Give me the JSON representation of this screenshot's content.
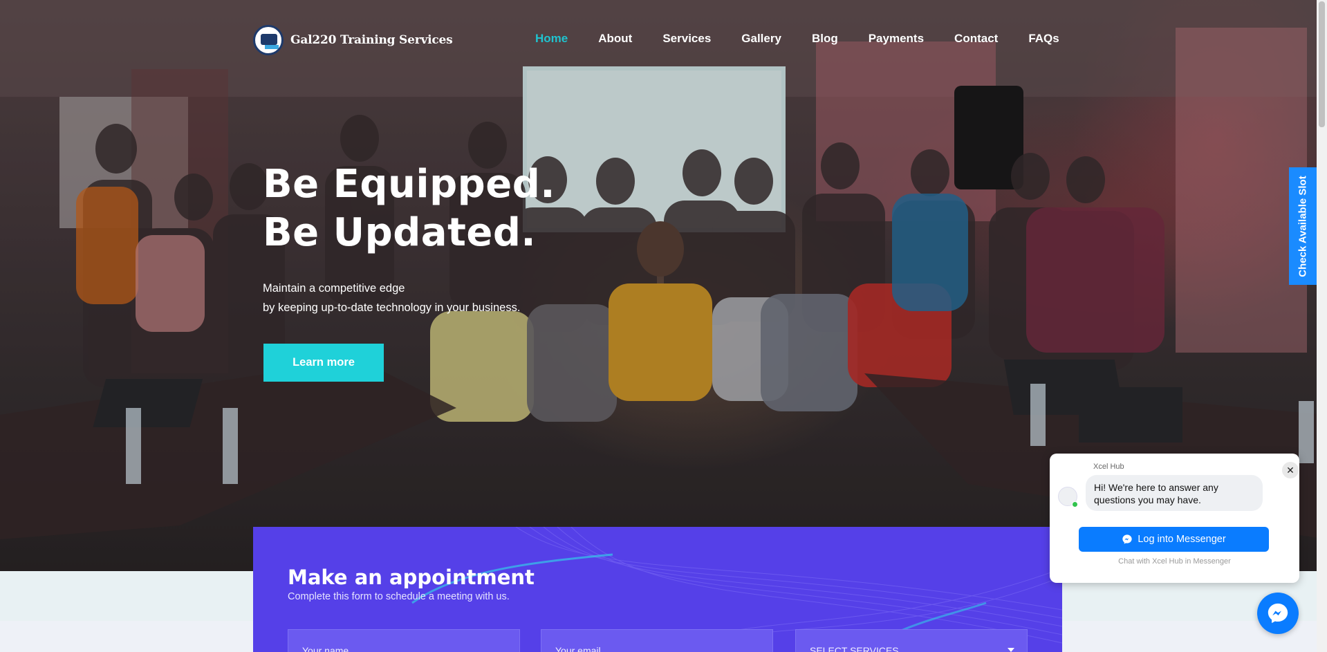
{
  "header": {
    "brand": "Gal220 Training Services",
    "nav": [
      {
        "label": "Home",
        "active": true
      },
      {
        "label": "About"
      },
      {
        "label": "Services"
      },
      {
        "label": "Gallery"
      },
      {
        "label": "Blog"
      },
      {
        "label": "Payments"
      },
      {
        "label": "Contact"
      },
      {
        "label": "FAQs"
      }
    ]
  },
  "hero": {
    "headline_line1": "Be Equipped.",
    "headline_line2": "Be Updated.",
    "sub_line1": "Maintain a competitive edge",
    "sub_line2": "by keeping up-to-date technology in your business.",
    "cta": "Learn more"
  },
  "side_tab": {
    "label": "Check Available Slot"
  },
  "appointment": {
    "title": "Make an appointment",
    "subtitle": "Complete this form to schedule a meeting with us.",
    "name_placeholder": "Your name",
    "email_placeholder": "Your email",
    "service_select": "SELECT SERVICES"
  },
  "messenger": {
    "page_name": "Xcel Hub",
    "greeting": "Hi! We're here to answer any questions you may have.",
    "login_button": "Log into Messenger",
    "footer": "Chat with Xcel Hub in Messenger"
  },
  "colors": {
    "accent": "#1fc3cf",
    "cta": "#1fd1d9",
    "appointment_bg": "#5540e8",
    "messenger_blue": "#0a7cff",
    "side_tab": "#1a8bff"
  },
  "icons": [
    "brand-logo-icon",
    "messenger-icon",
    "close-icon",
    "chevron-down-icon"
  ]
}
